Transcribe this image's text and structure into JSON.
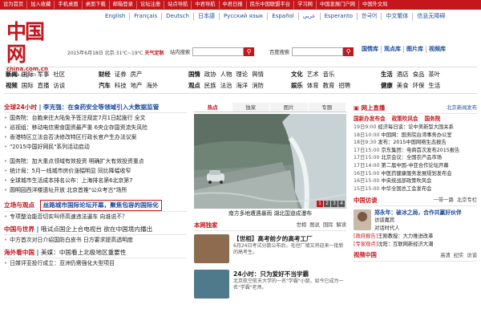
{
  "topbar": [
    "设为首页",
    "加入收藏",
    "手机桌面",
    "桌面下载",
    "邮箱登录",
    "论坛注册",
    "站点导航",
    "中君导航",
    "中君日报",
    "民乐中国联盟平台",
    "学习网",
    "中国发展门户网",
    "中国外文局"
  ],
  "languages": [
    "English",
    "Français",
    "Deutsch",
    "日本語",
    "Русский язык",
    "Español",
    "عربي",
    "Esperanto",
    "한국어",
    "中文繁体",
    "信息无障碍"
  ],
  "logo": {
    "zh": "中国网",
    "en": "china.com.cn",
    "en2": "china.org.cn"
  },
  "dateinfo": {
    "text": "2015年6月18日  北京:31℃~19℃",
    "highlight": "天气定制"
  },
  "search1": {
    "label": "站内搜索",
    "placeholder": ""
  },
  "search2": {
    "label": "百度搜索",
    "placeholder": ""
  },
  "rightnav": [
    "国情库",
    "观点库",
    "图片库",
    "视频库"
  ],
  "channels": {
    "col1": [
      [
        "新闻",
        "国际",
        "军事",
        "社区"
      ],
      [
        "视频",
        "国际",
        "直播",
        "访谈"
      ]
    ],
    "col2": [
      [
        "财经",
        "证券",
        "房产"
      ],
      [
        "汽车",
        "科技",
        "地产",
        "海外"
      ]
    ],
    "col3": [
      [
        "国情",
        "政协",
        "人物",
        "理论",
        "舆情"
      ],
      [
        "观点",
        "民族",
        "法治",
        "海洋",
        "消防"
      ]
    ],
    "col4": [
      [
        "文化",
        "艺术",
        "音乐"
      ],
      [
        "娱乐",
        "体育",
        "教育",
        "招聘"
      ]
    ],
    "col5": [
      [
        "生活",
        "酒店",
        "食品",
        "茶叶"
      ],
      [
        "健康",
        "美食",
        "环保",
        "生活"
      ]
    ]
  },
  "left": {
    "h1": "全球24小时",
    "h1sub": "李克强：在食药安全等领域引入大数据监管",
    "list1": [
      "国务院：台胞来往大陆免予签注规定7月1日起施行  全文",
      "巡视组：移动电信需食国资最严重  6央企存国资流失风险",
      "香港特区立法会否决修改特区行政长官产生办法议案",
      "\"2015中国好网民\"系列活动启动"
    ],
    "list2": [
      "国务院：加大重点领域有效投资  明确扩大有效投资重点",
      "统计局：5月一线城市房价涨幅明显  同比降幅收窄",
      "全球城市生活成本排名公布：上海排名第6北京第7",
      "圆明园西洋楼遗址开放  北京首推\"公众考古\"场所"
    ],
    "h2": "立场与观点",
    "h2box": "丝路城市国际论坛开幕，聚焦包容的国际化",
    "list3": [
      "专项整治能否切实叫停高速违法逼车  向谁说不？"
    ],
    "h3": "中国与世界",
    "h3sub": "哦试点国企上合电视台  欲在中国境内播出",
    "list4": [
      "中方首次对日介绍国防白皮书  日方要求提高透明度"
    ],
    "h4": "海外看中国",
    "h4sub": "美媒：中国看上北极地区重要性",
    "list5": [
      "日媒评亚投行成立：亚洲仍需强化大型项目"
    ]
  },
  "middle": {
    "tabs": [
      "热点",
      "独家",
      "图片",
      "专题"
    ],
    "pager": [
      "1",
      "2",
      "3",
      "4"
    ],
    "caption": "南方多地遭遇暴雨  湖北国道成瀑布",
    "sub_title": "本网独家",
    "sub_tags": [
      "世相",
      "图说",
      "国际",
      "解读"
    ],
    "features": [
      {
        "title": "【世相】高考前夕的高考工厂",
        "desc": "6月24日考试分数公布后，毛坦厂镇又将迎来一批新的高考生。"
      },
      {
        "title": "24小时：只为爱好不当学霸",
        "desc": "北京航空航天大学的一名\"学霸\"小朋，如今已成为一名\"学霸\"老师。"
      }
    ]
  },
  "right": {
    "title": "网上直播",
    "more": "北京新闻发布",
    "redlinks": [
      "国新办发布会",
      "政策吹风会",
      "国务院"
    ],
    "items": [
      {
        "time": "19日9:00",
        "text": "经济每日谈：论中美新型大国关系"
      },
      {
        "time": "18日10:00",
        "text": "中国网：国务院台湾事务办公室"
      },
      {
        "time": "18日9:30",
        "text": "发布：2015中国网络生态报告"
      },
      {
        "time": "17日15:00",
        "text": "京东集团：电商首次发布2015报告"
      },
      {
        "time": "17日15:00",
        "text": "北京会议：全国农产品市场"
      },
      {
        "time": "17日14:00",
        "text": "第二届中国-中亚合作论坛开幕"
      },
      {
        "time": "16日15:00",
        "text": "中医药健康服务发展规划发布会"
      },
      {
        "time": "16日15:00",
        "text": "中央统战部政策吹风会"
      },
      {
        "time": "15日15:00",
        "text": "中华全国总工会发布会"
      }
    ],
    "comment_title": "中国访谈",
    "comment_links": [
      "一带一路",
      "北京专栏"
    ],
    "comment_head": "郑永年：破冰之局，合作共赢好伙伴",
    "comment_rows": [
      "访谈嘉宾",
      "对话时代人"
    ],
    "ritems": [
      {
        "pre": "[政府报告]",
        "text": "王刚教授：大力推进改革"
      },
      {
        "pre": "[专家观点]",
        "text": "沈阳：互联网新经济大潮"
      }
    ],
    "video_title": "视频中国",
    "video_tags": [
      "高清",
      "纪实",
      "访谈"
    ]
  }
}
